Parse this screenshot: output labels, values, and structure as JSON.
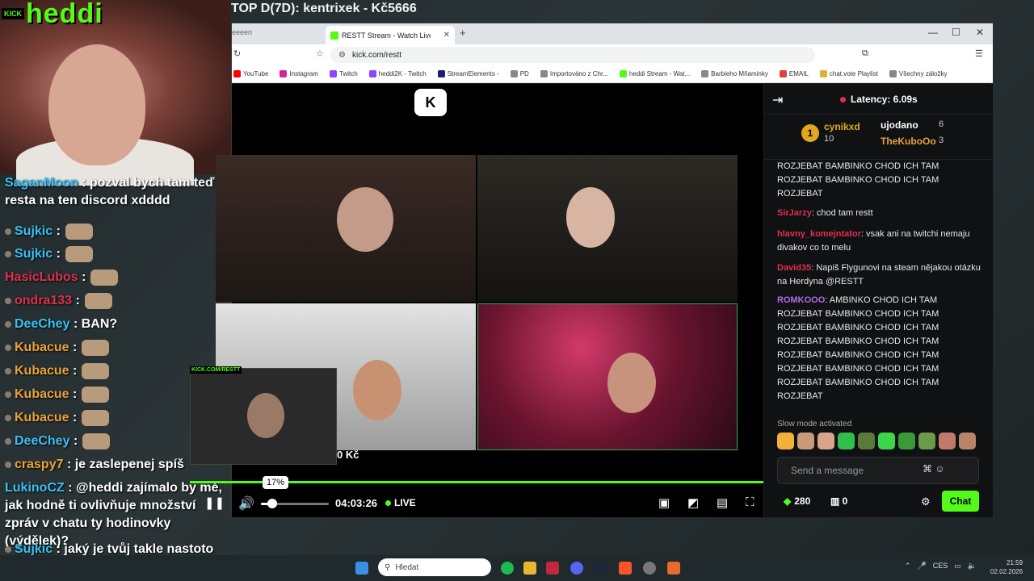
{
  "overlay": {
    "top_title": "TOP D(7D): kentrixek - Kč5666",
    "kick_badge": "KICK",
    "streamer": "heddi"
  },
  "overlay_chat": [
    {
      "user": "SaganMoon",
      "text": ": pozval bych tam teď resta na ten discord xdddd",
      "color": "#3bc0f3"
    },
    {
      "user": "Sujkic",
      "text": ":",
      "color": "#3bc0f3"
    },
    {
      "user": "Sujkic",
      "text": ":",
      "color": "#3bc0f3"
    },
    {
      "user": "HasicLubos",
      "text": ":",
      "color": "#e0304e"
    },
    {
      "user": "ondra133",
      "text": ":",
      "color": "#e0304e"
    },
    {
      "user": "DeeChey",
      "text": ": BAN?",
      "color": "#3bc0f3"
    },
    {
      "user": "Kubacue",
      "text": ":",
      "color": "#e8a33b"
    },
    {
      "user": "Kubacue",
      "text": ":",
      "color": "#e8a33b"
    },
    {
      "user": "Kubacue",
      "text": ":",
      "color": "#e8a33b"
    },
    {
      "user": "Kubacue",
      "text": ":",
      "color": "#e8a33b"
    },
    {
      "user": "DeeChey",
      "text": ":",
      "color": "#3bc0f3"
    },
    {
      "user": "craspy7",
      "text": ": je zaslepenej spíš",
      "color": "#e8a33b"
    },
    {
      "user": "LukinoCZ",
      "text": ": @heddi zajímalo by mě, jak hodně ti ovlivňuje množství zpráv v chatu ty hodinovky (výdělek)?",
      "color": "#3bc0f3"
    },
    {
      "user": "Sujkic",
      "text": ": jaký je tvůj takle nastoto téma?",
      "color": "#3bc0f3"
    }
  ],
  "browser": {
    "prev_tab": "eeeen",
    "tab_title": "RESTT Stream - Watch Live or",
    "url": "kick.com/restt",
    "bookmarks": [
      {
        "label": "YouTube",
        "color": "#ff0000"
      },
      {
        "label": "Instagram",
        "color": "#d6249f"
      },
      {
        "label": "Twitch",
        "color": "#9146ff"
      },
      {
        "label": "heddi2K - Twitch",
        "color": "#9146ff"
      },
      {
        "label": "StreamElements -",
        "color": "#1a1f71"
      },
      {
        "label": "PD",
        "color": "#888888"
      },
      {
        "label": "Importováno z Chr...",
        "color": "#888888"
      },
      {
        "label": "heddi Stream - Wat...",
        "color": "#53fc18"
      },
      {
        "label": "Barbieho Mňaminky",
        "color": "#888888"
      },
      {
        "label": "EMAIL",
        "color": "#e04040"
      },
      {
        "label": "chat.vote Playlist",
        "color": "#e0b030"
      },
      {
        "label": "Všechny záložky",
        "color": "#888888"
      }
    ]
  },
  "player": {
    "kick_logo": "K",
    "pip_label": "KICK.COM/RESTT",
    "donation": "0 Kč",
    "volume_tooltip": "17%",
    "volume_level": 0.17,
    "time": "04:03:26",
    "live": "LIVE"
  },
  "chat": {
    "latency": "Latency: 6.09s",
    "leaderboard": {
      "first": {
        "rank": "1",
        "name": "cynikxd",
        "count": "10"
      },
      "second": {
        "name": "ujodano",
        "count": "6"
      },
      "third": {
        "name": "TheKuboOo",
        "count": "3"
      }
    },
    "messages": [
      {
        "name": "",
        "text": "ROZJEBAT   BAMBINKO CHOD ICH TAM"
      },
      {
        "name": "",
        "text": "ROZJEBAT   BAMBINKO CHOD ICH TAM"
      },
      {
        "name": "",
        "text": "ROZJEBAT"
      },
      {
        "name": "SirJarzy",
        "text": ": chod tam restt"
      },
      {
        "name": "hlavny_komejntator",
        "text": ": vsak ani na twitchi nemaju divakov co to melu"
      },
      {
        "name": "David35",
        "text": ": Napiš Flygunovi na steam nějakou otázku na Herdyna @RESTT"
      },
      {
        "name": "ROMKOOO",
        "text": ": AMBINKO CHOD ICH TAM"
      },
      {
        "name": "",
        "text": "ROZJEBAT   BAMBINKO CHOD ICH TAM"
      },
      {
        "name": "",
        "text": "ROZJEBAT   BAMBINKO CHOD ICH TAM"
      },
      {
        "name": "",
        "text": "ROZJEBAT   BAMBINKO CHOD ICH TAM"
      },
      {
        "name": "",
        "text": "ROZJEBAT   BAMBINKO CHOD ICH TAM"
      },
      {
        "name": "",
        "text": "ROZJEBAT   BAMBINKO CHOD ICH TAM"
      },
      {
        "name": "",
        "text": "ROZJEBAT   BAMBINKO CHOD ICH TAM"
      },
      {
        "name": "",
        "text": "ROZJEBAT"
      }
    ],
    "slow_mode": "Slow mode activated",
    "placeholder": "Send a message",
    "points": "280",
    "drops": "0",
    "chat_button": "Chat"
  },
  "taskbar": {
    "search": "Hledat",
    "lang": "CES",
    "time": "21:59",
    "date": "02.02.2026"
  },
  "colors": {
    "kick_green": "#53fc18",
    "accent_red": "#e0304e"
  }
}
